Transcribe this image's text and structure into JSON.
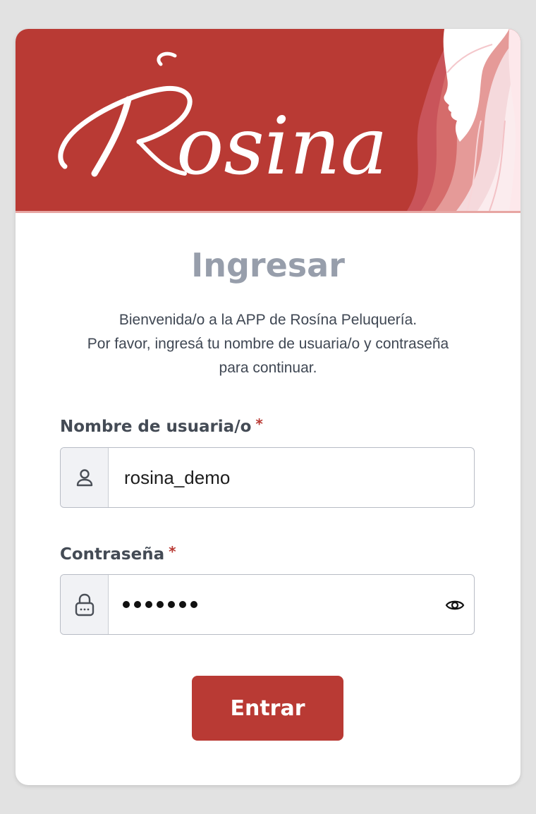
{
  "brand": {
    "logo_text": "Rosina",
    "accent_color": "#b93a34"
  },
  "login": {
    "title": "Ingresar",
    "welcome_lines": [
      "Bienvenida/o a la APP de Rosína Peluquería.",
      "Por favor, ingresá tu nombre de usuaria/o y contraseña",
      "para continuar."
    ],
    "username": {
      "label": "Nombre de usuaria/o",
      "required_mark": "*",
      "value": "rosina_demo",
      "icon": "user-icon"
    },
    "password": {
      "label": "Contraseña",
      "required_mark": "*",
      "masked_length": 7,
      "icon": "lock-icon",
      "toggle_icon": "eye-icon"
    },
    "submit_label": "Entrar"
  }
}
